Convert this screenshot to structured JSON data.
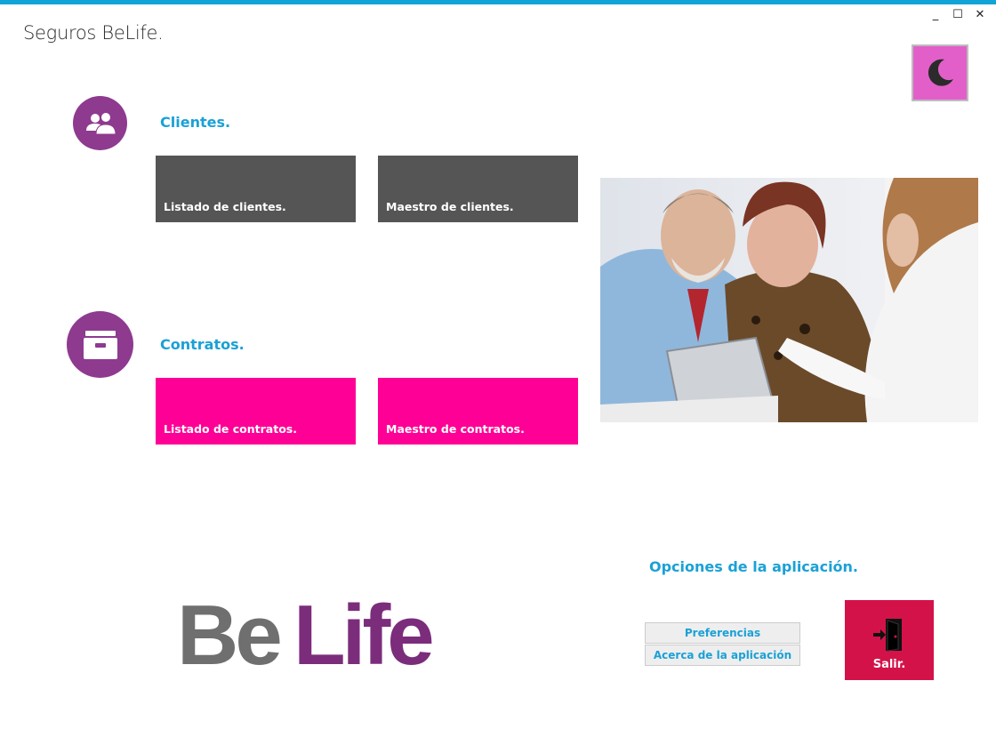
{
  "window": {
    "title": "Seguros BeLife.",
    "minimize_glyph": "_",
    "maximize_glyph": "☐",
    "close_glyph": "✕"
  },
  "theme_toggle": {
    "icon": "moon-icon",
    "color": "#e25fc9"
  },
  "clientes": {
    "title": "Clientes.",
    "icon": "users-icon",
    "tiles": [
      {
        "label": "Listado de clientes."
      },
      {
        "label": "Maestro de clientes."
      }
    ]
  },
  "contratos": {
    "title": "Contratos.",
    "icon": "file-cabinet-icon",
    "tiles": [
      {
        "label": "Listado de contratos."
      },
      {
        "label": "Maestro de contratos."
      }
    ]
  },
  "logo": {
    "part1": "Be",
    "part2": "Life"
  },
  "opciones": {
    "title": "Opciones de la aplicación.",
    "buttons": [
      {
        "label": "Preferencias"
      },
      {
        "label": "Acerca de la aplicación"
      }
    ],
    "exit_label": "Salir."
  },
  "colors": {
    "accent": "#1ba1d6",
    "purple": "#8e3a8f",
    "pink": "#ff0096",
    "dark_tile": "#555555",
    "exit": "#d4124a"
  }
}
